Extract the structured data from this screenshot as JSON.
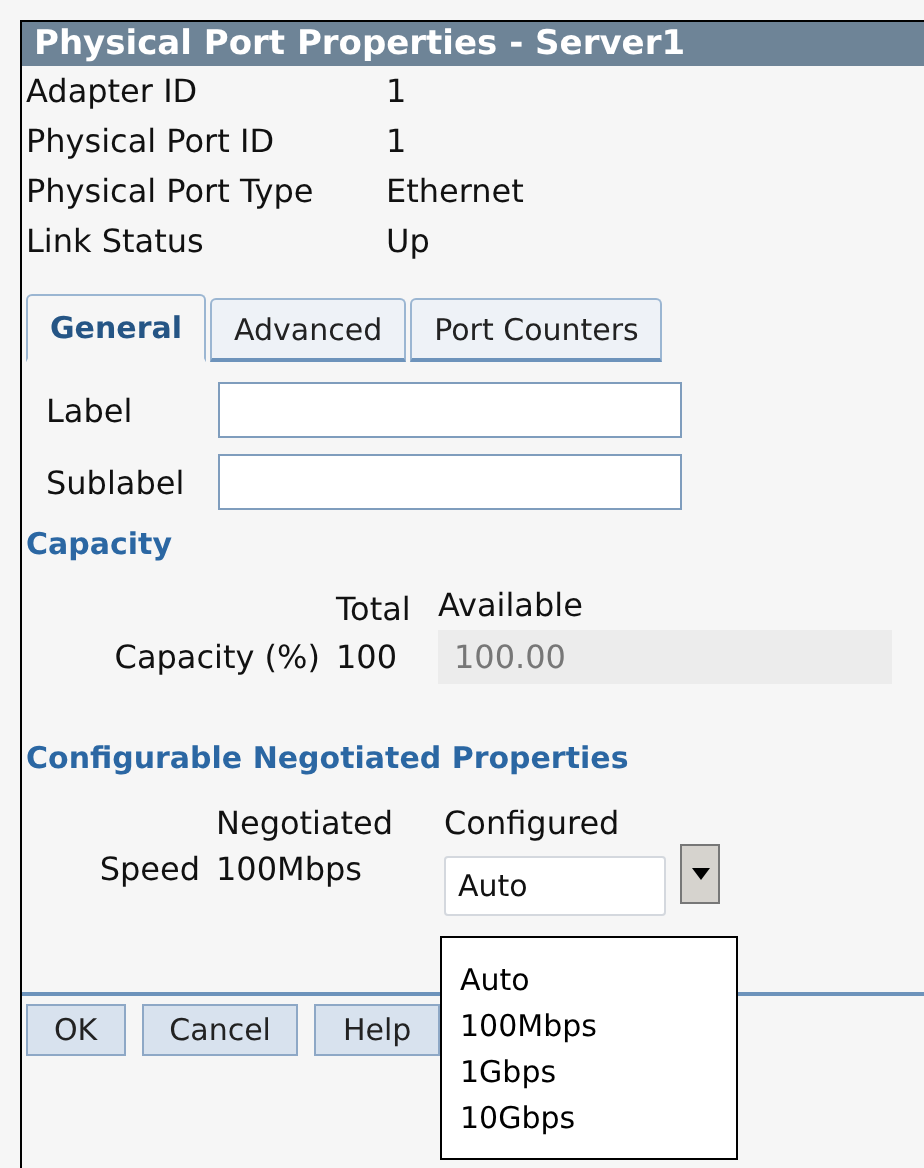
{
  "window": {
    "title": "Physical Port Properties - Server1"
  },
  "properties": [
    {
      "label": "Adapter ID",
      "value": "1"
    },
    {
      "label": "Physical Port ID",
      "value": "1"
    },
    {
      "label": "Physical Port Type",
      "value": "Ethernet"
    },
    {
      "label": "Link Status",
      "value": "Up"
    }
  ],
  "tabs": [
    {
      "label": "General",
      "selected": true
    },
    {
      "label": "Advanced",
      "selected": false
    },
    {
      "label": "Port Counters",
      "selected": false
    }
  ],
  "fields": [
    {
      "label": "Label"
    },
    {
      "label": "Sublabel"
    }
  ],
  "capacity": {
    "heading": "Capacity",
    "columns": [
      "Total",
      "Available"
    ],
    "row": {
      "label": "Capacity (%)",
      "total": "100",
      "available": "100.00",
      "disabled": true
    }
  },
  "negotiated": {
    "heading": "Configurable Negotiated Properties",
    "columns": [
      "Negotiated",
      "Configured"
    ],
    "row": {
      "label": "Speed",
      "negotiated": "100Mbps",
      "configured": "Auto",
      "expanded": true,
      "options": [
        "Auto",
        "100Mbps",
        "1Gbps",
        "10Gbps"
      ]
    }
  },
  "buttons": [
    "OK",
    "Cancel",
    "Help"
  ]
}
